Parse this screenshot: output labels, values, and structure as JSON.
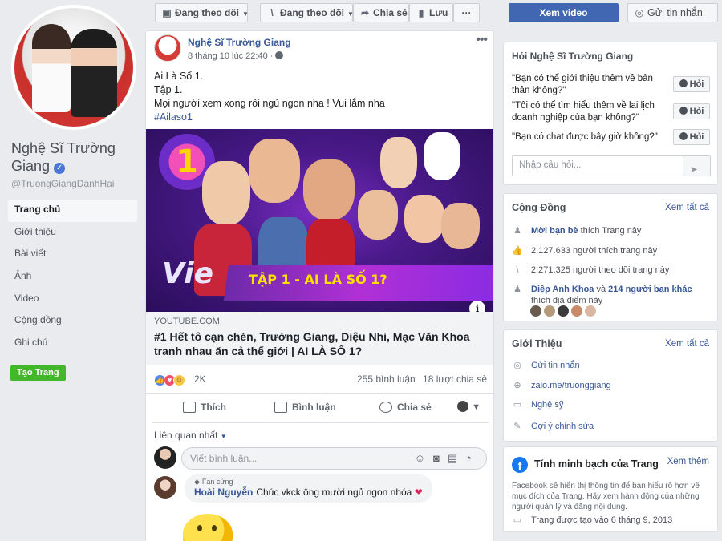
{
  "page": {
    "name": "Nghệ Sĩ Trường Giang",
    "handle": "@TruongGiangDanhHai",
    "verified_mark": "✓"
  },
  "nav": [
    {
      "label": "Trang chủ",
      "active": true
    },
    {
      "label": "Giới thiệu"
    },
    {
      "label": "Bài viết"
    },
    {
      "label": "Ảnh"
    },
    {
      "label": "Video"
    },
    {
      "label": "Cộng đồng"
    },
    {
      "label": "Ghi chú"
    }
  ],
  "create_page": "Tạo Trang",
  "toolbar": {
    "following": "Đang theo dõi",
    "following_feed": "Đang theo dõi",
    "share": "Chia sẻ",
    "save": "Lưu",
    "more": "···",
    "watch_video": "Xem video",
    "send_message": "Gửi tin nhắn"
  },
  "post": {
    "author": "Nghệ Sĩ Trường Giang",
    "time": "8 tháng 10 lúc 22:40 ·",
    "lines": [
      "Ai Là Số 1.",
      "Tập 1.",
      "Mọi người xem xong rồi ngủ ngon nha ! Vui lắm nha"
    ],
    "hashtag": "#Ailaso1",
    "thumb_banner": "TẬP 1 - AI LÀ SỐ 1?",
    "thumb_brand": "Vie",
    "thumb_number": "1",
    "info": "i",
    "link_domain": "YOUTUBE.COM",
    "link_title": "#1 Hết tô cạn chén, Trường Giang, Diệu Nhi, Mạc Văn Khoa tranh nhau ăn cả thế giới | AI LÀ SỐ 1?",
    "reaction_count": "2K",
    "comments_count": "255 bình luận",
    "shares_count": "18 lượt chia sẻ",
    "action_like": "Thích",
    "action_comment": "Bình luận",
    "action_share": "Chia sẻ",
    "sort_label": "Liên quan nhất",
    "comment_placeholder": "Viết bình luận...",
    "comment": {
      "badge": "Fan cứng",
      "author": "Hoài Nguyễn",
      "text": "Chúc vkck ông mười ngủ ngon nhóa",
      "emoji": "❤"
    }
  },
  "ask": {
    "title": "Hỏi Nghệ Sĩ Trường Giang",
    "questions": [
      "\"Bạn có thể giới thiệu thêm về bản thân không?\"",
      "\"Tôi có thể tìm hiểu thêm về lai lịch doanh nghiệp của bạn không?\"",
      "\"Bạn có chat được bây giờ không?\""
    ],
    "ask_label": "Hỏi",
    "input_placeholder": "Nhập câu hỏi...",
    "send": "➤"
  },
  "community": {
    "title": "Cộng Đồng",
    "see_all": "Xem tất cả",
    "invite_link": "Mời bạn bè",
    "invite_rest": " thích Trang này",
    "likes": "2.127.633 người thích trang này",
    "follows": "2.271.325 người theo dõi trang này",
    "friend_name": "Diệp Anh Khoa",
    "friend_mid": " và ",
    "friend_others": "214 người bạn khác",
    "friend_rest": " thích địa điểm này"
  },
  "about": {
    "title": "Giới Thiệu",
    "see_all": "Xem tất cả",
    "message": "Gửi tin nhắn",
    "website": "zalo.me/truonggiang",
    "category": "Nghệ sỹ",
    "suggest": "Gợi ý chỉnh sửa"
  },
  "transparency": {
    "title": "Tính minh bạch của Trang",
    "see_more": "Xem thêm",
    "logo": "f",
    "description": "Facebook sẽ hiển thị thông tin để bạn hiểu rõ hơn về mục đích của Trang. Hãy xem hành động của những người quản lý và đăng nội dung.",
    "created": "Trang được tạo vào 6 tháng 9, 2013"
  },
  "icons": [
    "check-icon",
    "bookmark-icon",
    "rss-icon",
    "share-icon",
    "save-icon",
    "more-icon",
    "messenger-icon",
    "globe-icon",
    "info-icon",
    "like-icon",
    "comment-icon",
    "share-icon",
    "emoji-icon",
    "camera-icon",
    "gif-icon",
    "sticker-icon",
    "send-icon",
    "people-icon",
    "thumb-icon",
    "rss-icon",
    "facebook-icon",
    "flag-icon",
    "pencil-icon",
    "clock-icon"
  ],
  "colors": {
    "brand": "#4267b2",
    "link": "#385898",
    "green": "#42b72a",
    "background": "#e9ebee"
  }
}
